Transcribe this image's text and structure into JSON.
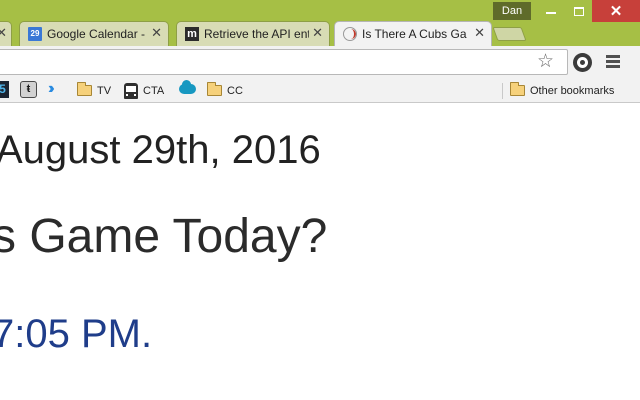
{
  "window": {
    "profile_name": "Dan",
    "accent_color": "#a6bf45",
    "controls": [
      "minimize-icon",
      "maximize-icon",
      "close-icon"
    ]
  },
  "tabs": [
    {
      "title": "",
      "close": "✕",
      "icon": "",
      "active": false
    },
    {
      "title": "Google Calendar - W",
      "close": "✕",
      "icon": "29",
      "active": false
    },
    {
      "title": "Retrieve the API ent",
      "close": "✕",
      "icon": "m",
      "active": false
    },
    {
      "title": "Is There A Cubs Gar",
      "close": "✕",
      "icon": "baseball-icon",
      "active": true
    }
  ],
  "toolbar": {
    "address_value": "",
    "icons": [
      "star-icon",
      "extension-icon",
      "menu-icon"
    ]
  },
  "bookmarks": {
    "items": [
      {
        "label": "5",
        "icon": "app-icon"
      },
      {
        "label": "",
        "icon": "bag-icon"
      },
      {
        "label": "",
        "icon": "chevrons-icon"
      },
      {
        "label": "TV",
        "icon": "folder-icon"
      },
      {
        "label": "CTA",
        "icon": "bus-icon"
      },
      {
        "label": "",
        "icon": "cloud-icon"
      },
      {
        "label": "CC",
        "icon": "folder-icon"
      }
    ],
    "other": "Other bookmarks"
  },
  "page": {
    "date": "August 29th, 2016",
    "question": "s Game Today?",
    "game_time": "7:05 PM."
  },
  "colors": {
    "game_time": "#1f3d8a",
    "close_button": "#c7403a"
  }
}
